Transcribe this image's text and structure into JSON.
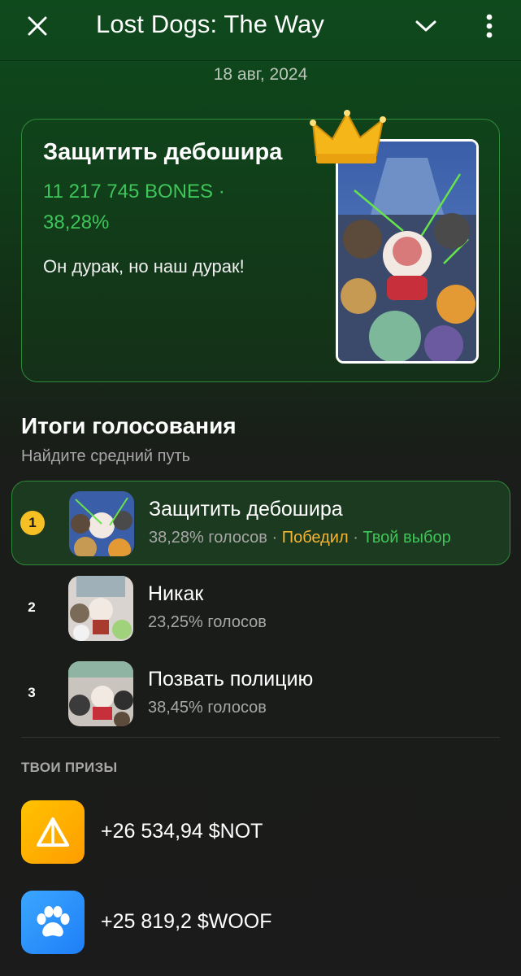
{
  "header": {
    "title": "Lost Dogs: The Way",
    "close_icon": "close-icon",
    "chevron_icon": "chevron-down-icon",
    "more_icon": "more-vertical-icon"
  },
  "date": "18 авг, 2024",
  "hero": {
    "title": "Защитить дебошира",
    "bones": "11 217 745 BONES · 38,28%",
    "quote": "Он дурак, но наш дурак!",
    "crown_icon": "crown-icon"
  },
  "results": {
    "title": "Итоги голосования",
    "subtitle": "Найдите средний путь",
    "items": [
      {
        "rank": "1",
        "name": "Защитить дебошира",
        "votes": "38,28% голосов",
        "won_label": "Победил",
        "choice_label": "Твой выбор"
      },
      {
        "rank": "2",
        "name": "Никак",
        "votes": "23,25% голосов"
      },
      {
        "rank": "3",
        "name": "Позвать полицию",
        "votes": "38,45% голосов"
      }
    ]
  },
  "prizes": {
    "title": "ТВОИ ПРИЗЫ",
    "items": [
      {
        "amount": "+26 534,94 $NOT",
        "icon": "not-coin-icon"
      },
      {
        "amount": "+25 819,2 $WOOF",
        "icon": "paw-icon"
      }
    ]
  },
  "colors": {
    "accent_green": "#3fc55a",
    "won_gold": "#f6b531",
    "rank_gold": "#f6c024",
    "not_yellow": "#ffb000",
    "woof_blue": "#2b90ff"
  }
}
